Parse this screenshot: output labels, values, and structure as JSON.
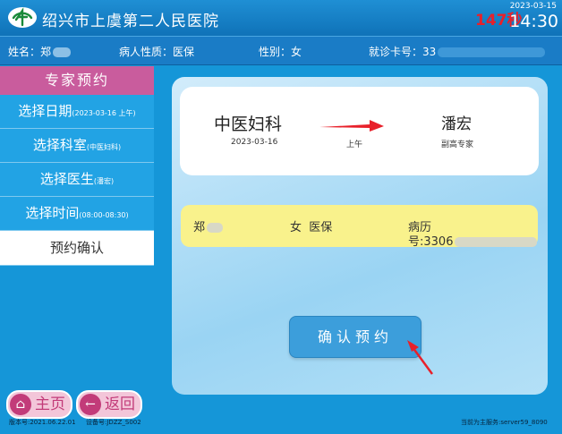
{
  "header": {
    "hospital_name": "绍兴市上虞第二人民医院",
    "countdown": "147秒",
    "date": "2023-03-15",
    "time": "14:30"
  },
  "patient_bar": {
    "name_label": "姓名：郑",
    "type_label": "病人性质：医保",
    "gender_label": "性别：女",
    "card_label": "就诊卡号：33"
  },
  "sidebar": {
    "title": "专家预约",
    "items": [
      {
        "label": "选择日期",
        "detail": "(2023-03-16 上午)"
      },
      {
        "label": "选择科室",
        "detail": "(中医妇科)"
      },
      {
        "label": "选择医生",
        "detail": "(潘宏)"
      },
      {
        "label": "选择时间",
        "detail": "(08:00-08:30)"
      },
      {
        "label": "预约确认",
        "detail": ""
      }
    ]
  },
  "appointment": {
    "department": "中医妇科",
    "date": "2023-03-16",
    "period": "上午",
    "doctor": "潘宏",
    "doctor_title": "副高专家"
  },
  "patient_info": {
    "name": "郑",
    "gender_type": "女  医保",
    "record_label": "病历",
    "record_no": "号:3306"
  },
  "confirm_label": "确认预约",
  "nav": {
    "home": "主页",
    "back": "返回"
  },
  "footer": {
    "version": "版本号:2021.06.22.01",
    "device": "设备号:JDZZ_S002",
    "server": "当前为主服务:server59_8090"
  },
  "colors": {
    "accent": "#1596d8",
    "sidebar_header": "#c95c9d",
    "highlight": "#f9f28c",
    "warning": "#e8202a"
  }
}
